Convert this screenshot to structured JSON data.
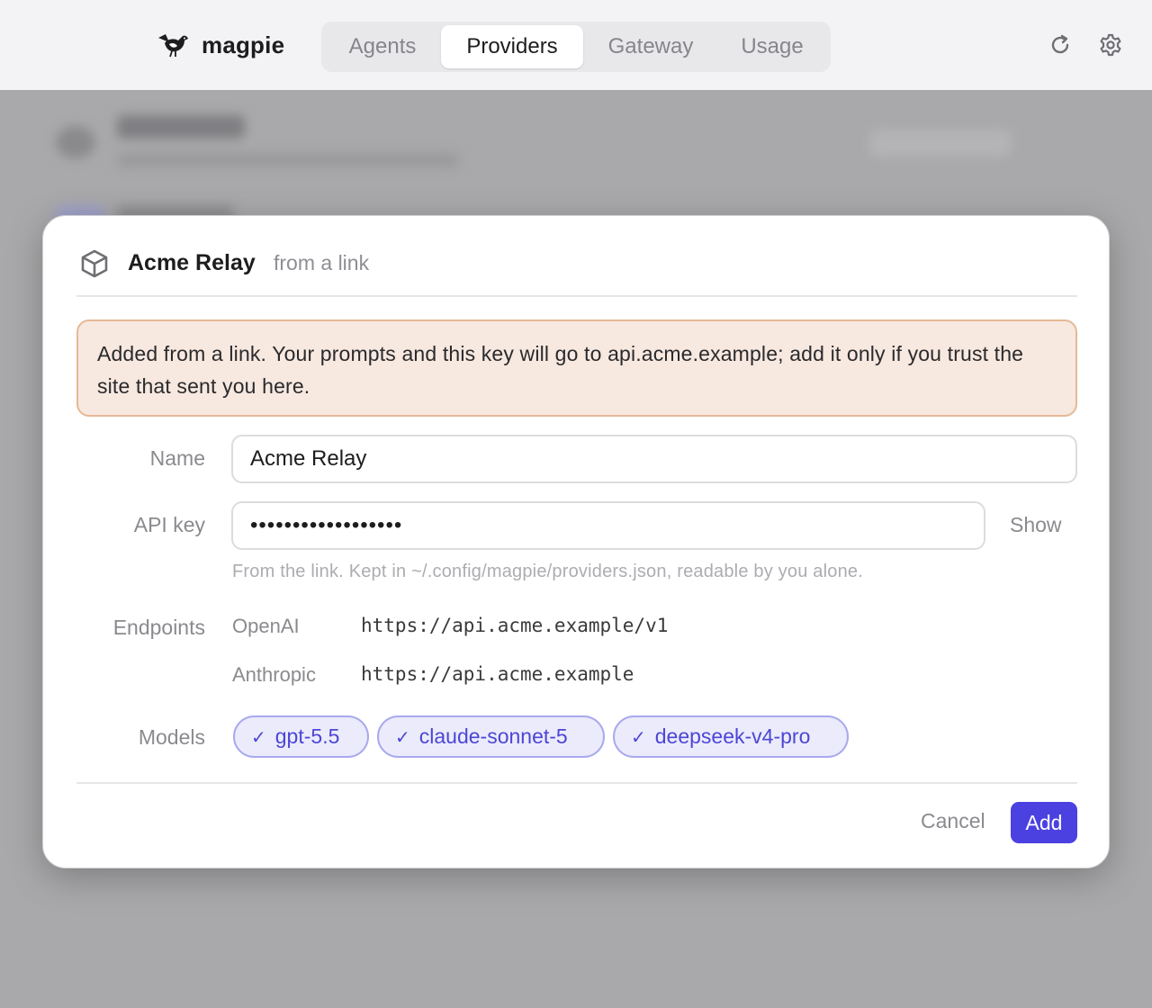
{
  "app": {
    "name": "magpie"
  },
  "nav": {
    "tabs": [
      "Agents",
      "Providers",
      "Gateway",
      "Usage"
    ],
    "active": "Providers"
  },
  "toolbar": {
    "icons": [
      "refresh-icon",
      "gear-icon"
    ]
  },
  "dialog": {
    "title": "Acme Relay",
    "subtitle": "from a link",
    "warning": "Added from a link. Your prompts and this key will go to api.acme.example; add it only if you trust the site that sent you here.",
    "name_label": "Name",
    "name_value": "Acme Relay",
    "api_key_label": "API key",
    "api_key_value": "••••••••••••••••••",
    "show_label": "Show",
    "api_key_hint": "From the link. Kept in ~/.config/magpie/providers.json, readable by you alone.",
    "endpoints_label": "Endpoints",
    "endpoints": [
      {
        "name": "OpenAI",
        "url": "https://api.acme.example/v1"
      },
      {
        "name": "Anthropic",
        "url": "https://api.acme.example"
      }
    ],
    "models_label": "Models",
    "models": [
      {
        "name": "gpt-5.5",
        "checked": true
      },
      {
        "name": "claude-sonnet-5",
        "checked": true
      },
      {
        "name": "deepseek-v4-pro",
        "checked": true
      }
    ],
    "cancel_label": "Cancel",
    "add_label": "Add"
  },
  "colors": {
    "accent": "#4b40e0",
    "warning_bg": "#f7e8e0",
    "warning_border": "#e5b995",
    "chip_bg": "#ebebfb",
    "chip_text": "#4c46d6"
  }
}
